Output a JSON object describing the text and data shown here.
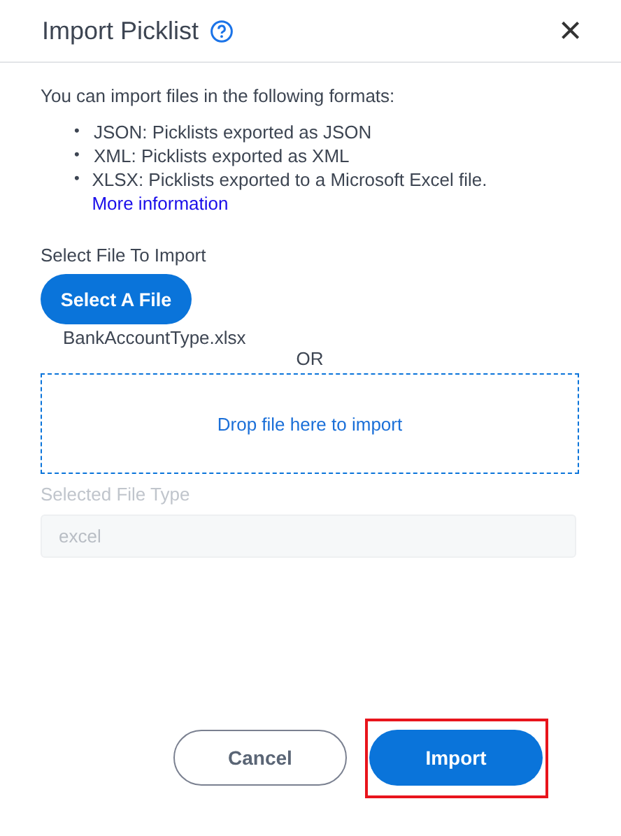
{
  "dialog": {
    "title": "Import Picklist",
    "help_icon": true,
    "close_glyph": "×"
  },
  "intro": "You can import files in the following formats:",
  "formats": [
    {
      "bullet": "•",
      "text": "JSON: Picklists exported as JSON"
    },
    {
      "bullet": "•",
      "text": "XML: Picklists exported as XML"
    },
    {
      "bullet": "•",
      "text": "XLSX: Picklists exported to a Microsoft Excel file. ",
      "link": "More information"
    }
  ],
  "file_section": {
    "label": "Select File To Import",
    "button": "Select A File",
    "file_name": "BankAccountType.xlsx",
    "or_text": "OR",
    "drop_zone": "Drop file here to import"
  },
  "file_type": {
    "label": "Selected File Type",
    "value": "excel",
    "disabled": true
  },
  "buttons": [
    {
      "label": "Cancel",
      "kind": "secondary",
      "highlighted": false
    },
    {
      "label": "Import",
      "kind": "primary",
      "highlighted": true
    }
  ]
}
